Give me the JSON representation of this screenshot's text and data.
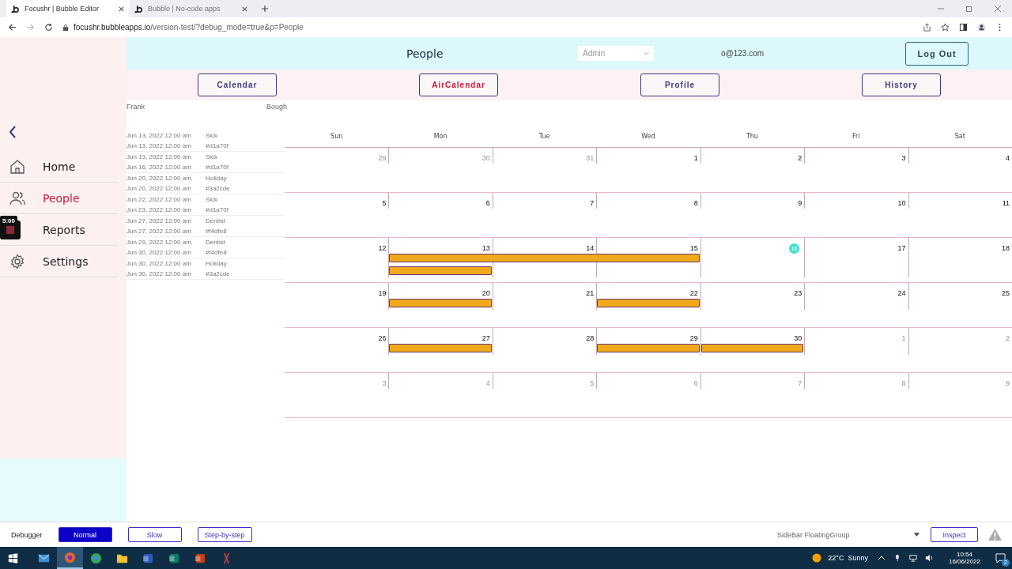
{
  "browser": {
    "tabs": [
      {
        "title": "Focushr | Bubble Editor",
        "selected": true
      },
      {
        "title": "Bubble | No-code apps",
        "selected": false
      }
    ],
    "url_host": "focushr.bubbleapps.io",
    "url_path": "/version-test/?debug_mode=true&p=People"
  },
  "header": {
    "title": "People",
    "role": "Admin",
    "email": "o@123.com",
    "logout": "Log Out"
  },
  "nav": [
    {
      "label": "Calendar",
      "selected": false
    },
    {
      "label": "AirCalendar",
      "selected": true
    },
    {
      "label": "Profile",
      "selected": false
    },
    {
      "label": "History",
      "selected": false
    }
  ],
  "sidebar": {
    "items": [
      {
        "label": "Home",
        "kind": "home",
        "selected": false
      },
      {
        "label": "People",
        "kind": "people",
        "selected": true
      },
      {
        "label": "Reports",
        "kind": "reports",
        "selected": false
      },
      {
        "label": "Settings",
        "kind": "settings",
        "selected": false
      }
    ]
  },
  "recorder": {
    "time": "5:00"
  },
  "person": {
    "first": "Frank",
    "last": "Bough"
  },
  "leaves": [
    {
      "start": "Jun 13, 2022 12:00 am",
      "type": "Sick",
      "end": "Jun 13, 2022 12:00 am",
      "code": "#d1a70f"
    },
    {
      "start": "Jun 13, 2022 12:00 am",
      "type": "Sick",
      "end": "Jun 16, 2022 12:00 am",
      "code": "#d1a70f"
    },
    {
      "start": "Jun 20, 2022 12:00 am",
      "type": "Holiday",
      "end": "Jun 20, 2022 12:00 am",
      "code": "#3a2cde"
    },
    {
      "start": "Jun 22, 2022 12:00 am",
      "type": "Sick",
      "end": "Jun 23, 2022 12:00 am",
      "code": "#d1a70f"
    },
    {
      "start": "Jun 27, 2022 12:00 am",
      "type": "Dentist",
      "end": "Jun 27, 2022 12:00 am",
      "code": "#f4dfe8"
    },
    {
      "start": "Jun 29, 2022 12:00 am",
      "type": "Dentist",
      "end": "Jun 30, 2022 12:00 am",
      "code": "#f4dfe8"
    },
    {
      "start": "Jun 30, 2022 12:00 am",
      "type": "Holiday",
      "end": "Jun 30, 2022 12:00 am",
      "code": "#3a2cde"
    }
  ],
  "calendar": {
    "weekdays": [
      "Sun",
      "Mon",
      "Tue",
      "Wed",
      "Thu",
      "Fri",
      "Sat"
    ],
    "weeks": [
      {
        "days": [
          {
            "num": "29",
            "muted": true
          },
          {
            "num": "30",
            "muted": true
          },
          {
            "num": "31",
            "muted": true
          },
          {
            "num": "1",
            "muted": false
          },
          {
            "num": "2",
            "muted": false
          },
          {
            "num": "3",
            "muted": false
          },
          {
            "num": "4",
            "muted": false
          }
        ]
      },
      {
        "days": [
          {
            "num": "5",
            "muted": false
          },
          {
            "num": "6",
            "muted": false
          },
          {
            "num": "7",
            "muted": false
          },
          {
            "num": "8",
            "muted": false
          },
          {
            "num": "9",
            "muted": false
          },
          {
            "num": "10",
            "muted": false
          },
          {
            "num": "11",
            "muted": false
          }
        ]
      },
      {
        "days": [
          {
            "num": "12",
            "muted": false
          },
          {
            "num": "13",
            "muted": false,
            "lanes": [
              {
                "kind": "start"
              },
              {
                "kind": "start"
              }
            ]
          },
          {
            "num": "14",
            "muted": false,
            "lanes": [
              {
                "kind": "continue"
              }
            ]
          },
          {
            "num": "15",
            "muted": false,
            "lanes": [
              {
                "kind": "continue"
              }
            ]
          },
          {
            "num": "16",
            "muted": false,
            "today": true
          },
          {
            "num": "17",
            "muted": false
          },
          {
            "num": "18",
            "muted": false
          }
        ]
      },
      {
        "days": [
          {
            "num": "19",
            "muted": false
          },
          {
            "num": "20",
            "muted": false,
            "lanes": [
              {
                "kind": "start"
              }
            ]
          },
          {
            "num": "21",
            "muted": false
          },
          {
            "num": "22",
            "muted": false,
            "lanes": [
              {
                "kind": "start"
              }
            ]
          },
          {
            "num": "23",
            "muted": false
          },
          {
            "num": "24",
            "muted": false
          },
          {
            "num": "25",
            "muted": false
          }
        ]
      },
      {
        "days": [
          {
            "num": "26",
            "muted": false
          },
          {
            "num": "27",
            "muted": false,
            "lanes": [
              {
                "kind": "start"
              }
            ]
          },
          {
            "num": "28",
            "muted": false
          },
          {
            "num": "29",
            "muted": false,
            "lanes": [
              {
                "kind": "start"
              }
            ]
          },
          {
            "num": "30",
            "muted": false,
            "lanes": [
              {
                "kind": "start"
              }
            ]
          },
          {
            "num": "1",
            "muted": true
          },
          {
            "num": "2",
            "muted": true
          }
        ]
      },
      {
        "days": [
          {
            "num": "3",
            "muted": true
          },
          {
            "num": "4",
            "muted": true
          },
          {
            "num": "5",
            "muted": true
          },
          {
            "num": "6",
            "muted": true
          },
          {
            "num": "7",
            "muted": true
          },
          {
            "num": "8",
            "muted": true
          },
          {
            "num": "9",
            "muted": true
          }
        ]
      }
    ]
  },
  "debugger": {
    "label": "Debugger",
    "modes": [
      {
        "label": "Normal",
        "selected": true
      },
      {
        "label": "Slow",
        "selected": false
      },
      {
        "label": "Step-by-step",
        "selected": false
      }
    ],
    "element": "SideBar FloatingGroup",
    "inspect": "Inspect"
  },
  "taskbar": {
    "apps": [
      {
        "kind": "mail",
        "selected": false
      },
      {
        "kind": "firefox",
        "selected": true
      },
      {
        "kind": "chrome",
        "selected": false
      },
      {
        "kind": "folder",
        "selected": false
      },
      {
        "kind": "word",
        "selected": false
      },
      {
        "kind": "publisher",
        "selected": false
      },
      {
        "kind": "powerpoint",
        "selected": false
      },
      {
        "kind": "snip",
        "selected": false
      }
    ],
    "weather": "22°C  Sunny",
    "time": "10:54",
    "date": "16/06/2022",
    "notifications": "2"
  }
}
